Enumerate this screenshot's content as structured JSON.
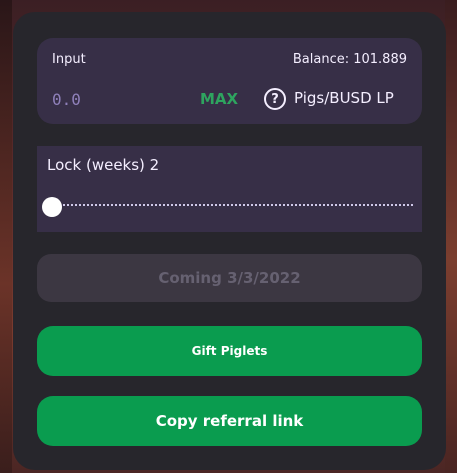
{
  "input_panel": {
    "label": "Input",
    "balance": "Balance: 101.889",
    "amount_placeholder": "0.0",
    "max_label": "MAX",
    "help_glyph": "?",
    "token": "Pigs/BUSD LP"
  },
  "lock_panel": {
    "label": "Lock (weeks) 2",
    "slider_value_fraction": 0.0
  },
  "buttons": {
    "coming": "Coming 3/3/2022",
    "gift": "Gift Piglets",
    "copy_referral": "Copy referral link"
  },
  "colors": {
    "card": "#27262c",
    "panel": "#372f47",
    "green": "#0a9c4f",
    "max": "#2ea45f"
  },
  "icons": {
    "help": "question-circle-icon"
  }
}
